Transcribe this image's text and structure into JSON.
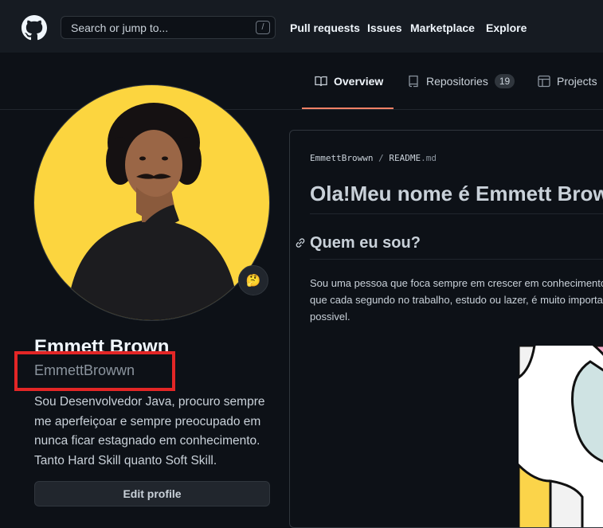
{
  "header": {
    "search_placeholder": "Search or jump to...",
    "search_shortcut": "/",
    "nav": [
      "Pull requests",
      "Issues",
      "Marketplace",
      "Explore"
    ]
  },
  "tabs": {
    "overview": "Overview",
    "repositories": "Repositories",
    "repositories_count": "19",
    "projects": "Projects"
  },
  "profile": {
    "emoji": "🤔",
    "full_name": "Emmett Brown",
    "username": "EmmettBrowwn",
    "bio": "Sou Desenvolvedor Java, procuro sempre me aperfeiçoar e sempre preocupado em nunca ficar estagnado em conhecimento. Tanto Hard Skill quanto Soft Skill.",
    "edit_button": "Edit profile"
  },
  "readme": {
    "owner": "EmmettBrowwn",
    "separator": "/",
    "file": "README",
    "ext": ".md",
    "heading1": "Ola!Meu nome é Emmett Brown",
    "heading2": "Quem eu sou?",
    "paragraph_lines": [
      "Sou uma pessoa que foca sempre em crescer em conhecimento",
      "que cada segundo no trabalho, estudo ou lazer, é muito importante",
      "possivel."
    ]
  },
  "colors": {
    "accent_underline": "#f78166",
    "highlight_box": "#e32626",
    "avatar_bg": "#fcd53f"
  }
}
